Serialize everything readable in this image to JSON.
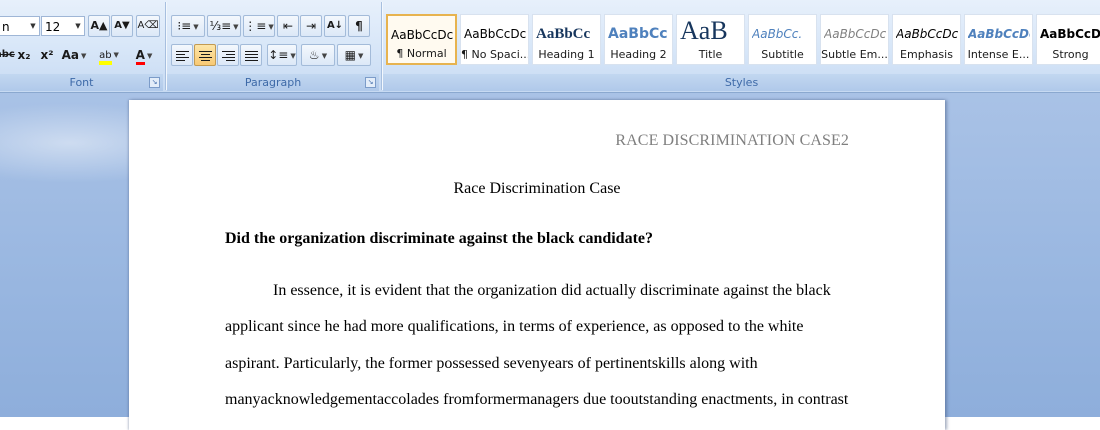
{
  "ribbon": {
    "font": {
      "label": "Font",
      "font_name": "n",
      "font_size": "12",
      "grow_icon": "A▲",
      "shrink_icon": "A▼",
      "clear_icon": "A⌫",
      "strike": "abc",
      "subscript": "x₂",
      "superscript": "x²",
      "change_case": "Aa",
      "highlight": "ab",
      "font_color": "A"
    },
    "paragraph": {
      "label": "Paragraph",
      "show_marks": "¶"
    },
    "styles": {
      "label": "Styles",
      "items": [
        {
          "sample": "AaBbCcDc",
          "name": "¶ Normal"
        },
        {
          "sample": "AaBbCcDc",
          "name": "¶ No Spaci..."
        },
        {
          "sample": "AaBbCc",
          "name": "Heading 1"
        },
        {
          "sample": "AaBbCc",
          "name": "Heading 2"
        },
        {
          "sample": "AaB",
          "name": "Title"
        },
        {
          "sample": "AaBbCc.",
          "name": "Subtitle"
        },
        {
          "sample": "AaBbCcDc",
          "name": "Subtle Em..."
        },
        {
          "sample": "AaBbCcDc",
          "name": "Emphasis"
        },
        {
          "sample": "AaBbCcDc",
          "name": "Intense E..."
        },
        {
          "sample": "AaBbCcDc",
          "name": "Strong"
        }
      ]
    }
  },
  "document": {
    "header": "RACE DISCRIMINATION CASE2",
    "title": "Race Discrimination Case",
    "question": "Did the organization discriminate against the black candidate?",
    "lines": [
      "In essence, it is evident that the organization did actually discriminate against the black",
      "applicant since he had more qualifications, in terms of experience, as opposed to the white",
      "aspirant. Particularly, the former possessed sevenyears of pertinentskills along with",
      "manyacknowledgementaccolades fromformermanagers due tooutstanding enactments, in contrast"
    ]
  },
  "colors": {
    "accent": "#15428b",
    "selected_style": "#e7b34f",
    "workspace": "#9bb8e1"
  }
}
